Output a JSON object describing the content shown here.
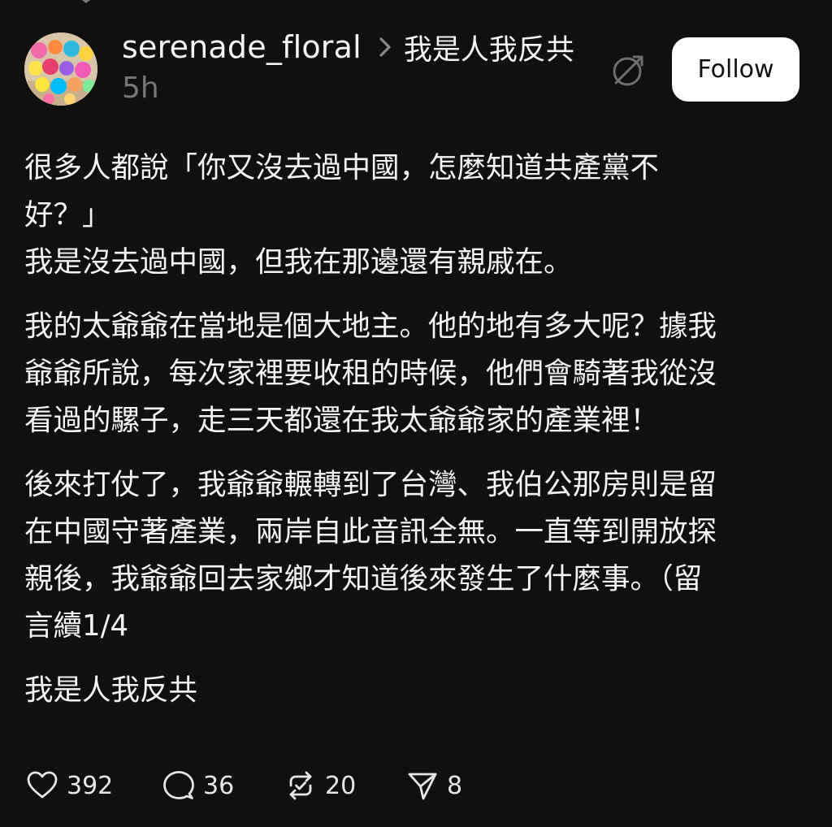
{
  "post": {
    "username": "serenade_floral",
    "topic": "我是人我反共",
    "time": "5h",
    "follow_label": "Follow",
    "paragraphs": [
      [
        "很多人都說「你又沒去過中國，怎麼知道共產黨不",
        "好？」",
        "我是沒去過中國，但我在那邊還有親戚在。"
      ],
      [
        "我的太爺爺在當地是個大地主。他的地有多大呢？據我",
        "爺爺所說，每次家裡要收租的時候，他們會騎著我從沒",
        "看過的騾子，走三天都還在我太爺爺家的產業裡！"
      ],
      [
        "後來打仗了，我爺爺輾轉到了台灣、我伯公那房則是留",
        "在中國守著產業，兩岸自此音訊全無。一直等到開放探",
        "親後，我爺爺回去家鄉才知道後來發生了什麼事。（留",
        "言續1/4"
      ],
      [
        "我是人我反共"
      ]
    ],
    "stats": {
      "likes": "392",
      "comments": "36",
      "reposts": "20",
      "shares": "8"
    },
    "icons": {
      "like": "heart-icon",
      "comment": "comment-bubble-icon",
      "repost": "repost-icon",
      "share": "send-icon",
      "mute": "mute-icon",
      "separator": "chevron-right-icon"
    },
    "colors": {
      "background": "#101010",
      "text": "#f3f5f7",
      "muted": "#777777",
      "follow_bg": "#ffffff"
    }
  }
}
